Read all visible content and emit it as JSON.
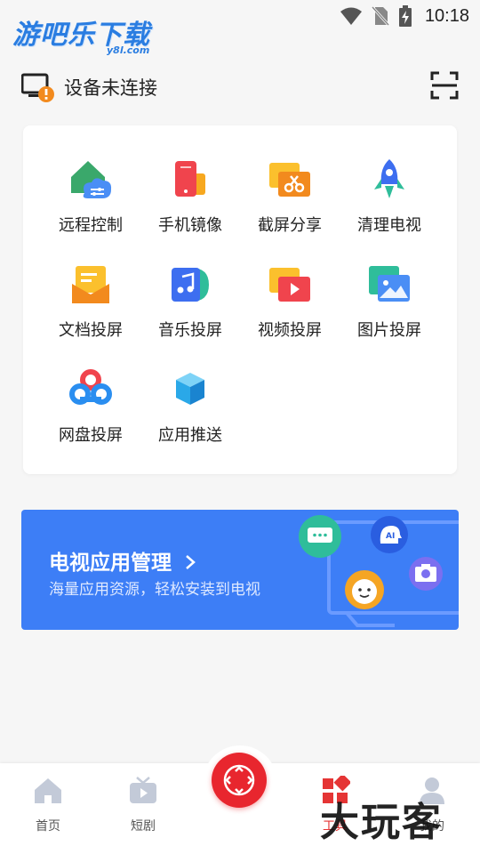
{
  "status_bar": {
    "time": "10:18"
  },
  "brand": {
    "logo_text": "游吧乐下载",
    "logo_sub": "y8l.com"
  },
  "device": {
    "status_label": "设备未连接",
    "scan_icon": "scan-icon"
  },
  "tools": [
    {
      "id": "remote-control",
      "label": "远程控制",
      "icon": "house-cloud-icon",
      "color": "#3aa86b"
    },
    {
      "id": "phone-mirror",
      "label": "手机镜像",
      "icon": "phone-mirror-icon",
      "color": "#f0444d"
    },
    {
      "id": "screenshot-share",
      "label": "截屏分享",
      "icon": "scissors-icon",
      "color": "#f79a1f"
    },
    {
      "id": "clean-tv",
      "label": "清理电视",
      "icon": "rocket-icon",
      "color": "#3d6ef0"
    },
    {
      "id": "doc-cast",
      "label": "文档投屏",
      "icon": "document-icon",
      "color": "#f7a81f"
    },
    {
      "id": "music-cast",
      "label": "音乐投屏",
      "icon": "music-icon",
      "color": "#3d6ef0"
    },
    {
      "id": "video-cast",
      "label": "视频投屏",
      "icon": "video-play-icon",
      "color": "#f0444d"
    },
    {
      "id": "image-cast",
      "label": "图片投屏",
      "icon": "image-icon",
      "color": "#2fbd9a"
    },
    {
      "id": "netdisk-cast",
      "label": "网盘投屏",
      "icon": "cloud-ring-icon",
      "color": "#2a8ef0"
    },
    {
      "id": "app-push",
      "label": "应用推送",
      "icon": "cube-icon",
      "color": "#2aa8e8"
    }
  ],
  "banner": {
    "title": "电视应用管理",
    "subtitle": "海量应用资源，轻松安装到电视",
    "chevron": "chevron-right-icon"
  },
  "bottom_nav": {
    "items": [
      {
        "id": "home",
        "label": "首页",
        "icon": "home-icon",
        "active": false
      },
      {
        "id": "drama",
        "label": "短剧",
        "icon": "tv-icon",
        "active": false
      },
      {
        "id": "tools",
        "label": "工具",
        "icon": "grid-icon",
        "active": true
      },
      {
        "id": "mine",
        "label": "我的",
        "icon": "user-icon",
        "active": false
      }
    ],
    "center_icon": "remote-dpad-icon"
  },
  "watermark": "大玩客"
}
